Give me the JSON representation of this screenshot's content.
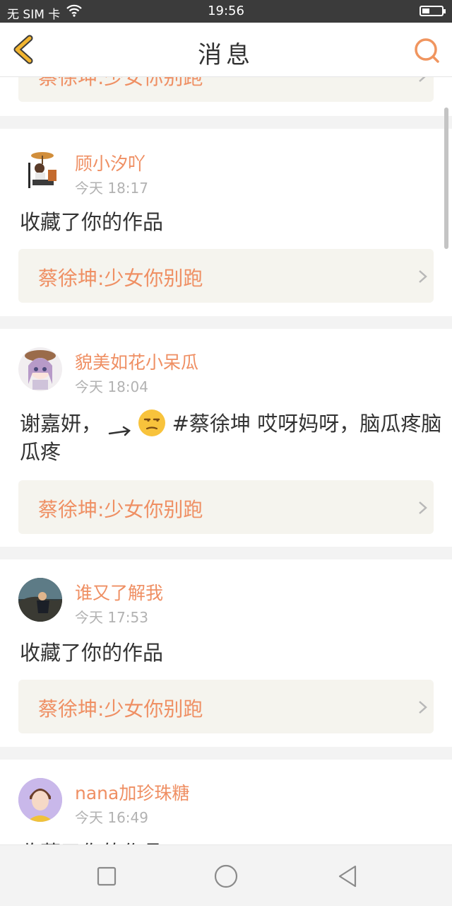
{
  "status_bar": {
    "carrier": "无 SIM 卡",
    "time": "19:56"
  },
  "header": {
    "title": "消息"
  },
  "top_partial": {
    "work_title": "蔡徐坤:少女你别跑"
  },
  "messages": [
    {
      "username": "顾小汐吖",
      "time": "今天 18:17",
      "text": "收藏了你的作品",
      "work_title": "蔡徐坤:少女你别跑"
    },
    {
      "username": "貌美如花小呆瓜",
      "time": "今天 18:04",
      "text_before_emoji": "谢嘉妍，",
      "text_after_emoji": "#蔡徐坤 哎呀妈呀，脑瓜疼脑瓜疼",
      "work_title": "蔡徐坤:少女你别跑"
    },
    {
      "username": "谁又了解我",
      "time": "今天 17:53",
      "text": "收藏了你的作品",
      "work_title": "蔡徐坤:少女你别跑"
    },
    {
      "username": "nana加珍珠糖",
      "time": "今天 16:49",
      "text": "收藏了你的作品"
    }
  ],
  "colors": {
    "accent": "#ef8f63",
    "link_bg": "#f5f4ee",
    "status_bar": "#3b3b3b",
    "back_icon": "#f2b530"
  },
  "icons": {
    "back": "chevron-left-icon",
    "search": "search-icon",
    "link": "chevron-right-icon",
    "sys_recent": "square-icon",
    "sys_home": "circle-icon",
    "sys_back": "triangle-back-icon"
  }
}
